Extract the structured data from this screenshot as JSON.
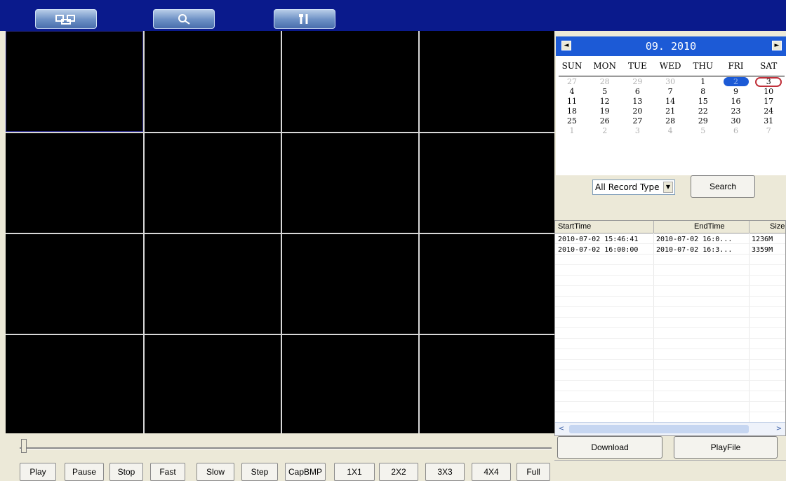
{
  "toolbar": {
    "buttons": [
      {
        "name": "playback-icon"
      },
      {
        "name": "search-icon"
      },
      {
        "name": "tools-icon"
      }
    ]
  },
  "calendar": {
    "title": "09. 2010",
    "prev": "◄",
    "next": "►",
    "weekdays": [
      "SUN",
      "MON",
      "TUE",
      "WED",
      "THU",
      "FRI",
      "SAT"
    ],
    "weeks": [
      [
        "27",
        "28",
        "29",
        "30",
        "1",
        "2",
        "3"
      ],
      [
        "4",
        "5",
        "6",
        "7",
        "8",
        "9",
        "10"
      ],
      [
        "11",
        "12",
        "13",
        "14",
        "15",
        "16",
        "17"
      ],
      [
        "18",
        "19",
        "20",
        "21",
        "22",
        "23",
        "24"
      ],
      [
        "25",
        "26",
        "27",
        "28",
        "29",
        "30",
        "31"
      ],
      [
        "1",
        "2",
        "3",
        "4",
        "5",
        "6",
        "7"
      ]
    ],
    "selected_day": "2",
    "today_day": "3",
    "colors": {
      "header": "#1c5ad6",
      "selected": "#1c5ad6",
      "today_circle": "#c0303a"
    }
  },
  "search": {
    "record_type": "All Record Type",
    "search_label": "Search"
  },
  "file_list": {
    "columns": [
      "StartTime",
      "EndTime",
      "Size"
    ],
    "rows": [
      [
        "2010-07-02 15:46:41",
        "2010-07-02 16:0...",
        "1236M"
      ],
      [
        "2010-07-02 16:00:00",
        "2010-07-02 16:3...",
        "3359M"
      ]
    ],
    "scroll_left": "<",
    "scroll_right": ">"
  },
  "actions": {
    "download_label": "Download",
    "playfile_label": "PlayFile"
  },
  "controls": [
    "Play",
    "Pause",
    "Stop",
    "Fast",
    "Slow",
    "Step",
    "CapBMP",
    "1X1",
    "2X2",
    "3X3",
    "4X4",
    "Full"
  ],
  "video_grid": {
    "rows": 4,
    "cols": 4
  }
}
